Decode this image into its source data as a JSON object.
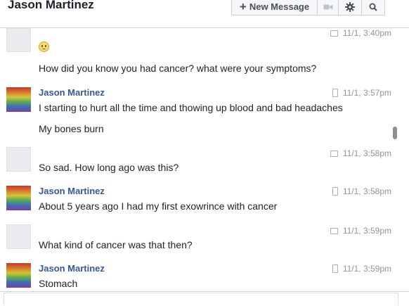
{
  "header": {
    "title": "Jason Martinez",
    "new_message_label": "New Message",
    "icons": [
      "video-icon",
      "gear-icon",
      "search-icon"
    ]
  },
  "messages": [
    {
      "sender": "",
      "device": "chat",
      "time": "11/1, 3:40pm",
      "emoji": "worried-face",
      "lines": [
        "How did you know you had cancer? what were your symptoms?"
      ]
    },
    {
      "sender": "Jason Martinez",
      "device": "phone",
      "time": "11/1, 3:57pm",
      "lines": [
        "I starting to hurt all the time and thowing up blood and bad headaches",
        "My bones burn"
      ]
    },
    {
      "sender": "",
      "device": "chat",
      "time": "11/1, 3:58pm",
      "lines": [
        "So sad.  How long ago was this?"
      ]
    },
    {
      "sender": "Jason Martinez",
      "device": "phone",
      "time": "11/1, 3:58pm",
      "lines": [
        "About 5 years ago I had my first exowrince with cancer"
      ]
    },
    {
      "sender": "",
      "device": "chat",
      "time": "11/1, 3:59pm",
      "lines": [
        "What kind of cancer was that then?"
      ]
    },
    {
      "sender": "Jason Martinez",
      "device": "phone",
      "time": "11/1, 3:59pm",
      "lines": [
        "Stomach"
      ]
    }
  ],
  "colors": {
    "sender_link": "#365899",
    "meta_text": "#90949c",
    "message_text": "#1d2129"
  }
}
